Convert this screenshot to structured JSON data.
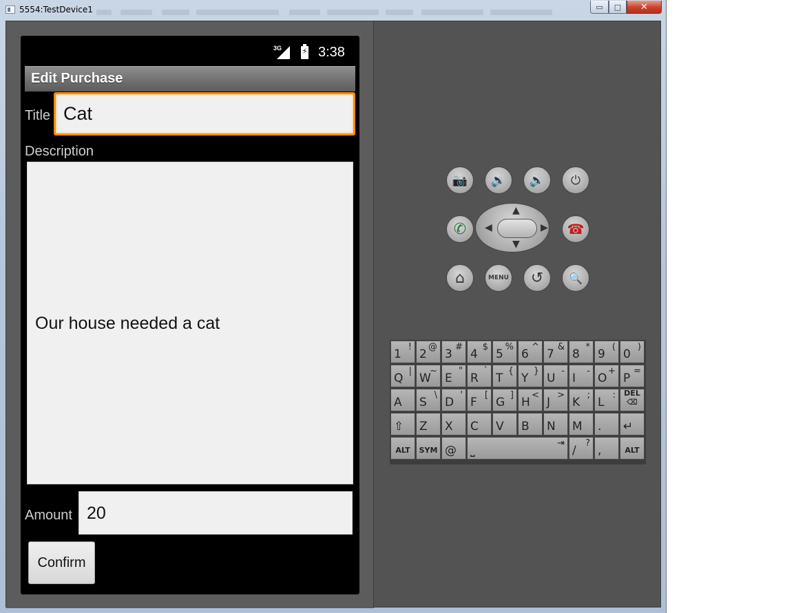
{
  "window": {
    "title": "5554:TestDevice1",
    "minimize_glyph": "▭",
    "maximize_glyph": "□",
    "close_glyph": "✕"
  },
  "status_bar": {
    "network": "3G",
    "time": "3:38"
  },
  "app": {
    "title": "Edit Purchase",
    "title_label": "Title",
    "title_value": "Cat",
    "description_label": "Description",
    "description_value": "Our house needed a cat",
    "amount_label": "Amount",
    "amount_value": "20",
    "confirm_label": "Confirm"
  },
  "controls": {
    "camera": "📷",
    "volume_down": "🔉",
    "volume_up": "🔊",
    "power": "⏻",
    "call": "✆",
    "end_call": "☎",
    "home": "⌂",
    "menu": "MENU",
    "back": "↺",
    "search": "🔍",
    "dpad_up": "▲",
    "dpad_down": "▼",
    "dpad_left": "◀",
    "dpad_right": "▶"
  },
  "keyboard": {
    "rows": [
      [
        {
          "k": "1",
          "a": "!"
        },
        {
          "k": "2",
          "a": "@"
        },
        {
          "k": "3",
          "a": "#"
        },
        {
          "k": "4",
          "a": "$"
        },
        {
          "k": "5",
          "a": "%"
        },
        {
          "k": "6",
          "a": "^"
        },
        {
          "k": "7",
          "a": "&"
        },
        {
          "k": "8",
          "a": "*"
        },
        {
          "k": "9",
          "a": "("
        },
        {
          "k": "0",
          "a": ")"
        }
      ],
      [
        {
          "k": "Q",
          "a": "|"
        },
        {
          "k": "W",
          "a": "~"
        },
        {
          "k": "E",
          "a": "\""
        },
        {
          "k": "R",
          "a": "`"
        },
        {
          "k": "T",
          "a": "{"
        },
        {
          "k": "Y",
          "a": "}"
        },
        {
          "k": "U",
          "a": "-"
        },
        {
          "k": "I",
          "a": "-"
        },
        {
          "k": "O",
          "a": "+"
        },
        {
          "k": "P",
          "a": "="
        }
      ],
      [
        {
          "k": "A",
          "a": ""
        },
        {
          "k": "S",
          "a": "\\"
        },
        {
          "k": "D",
          "a": "'"
        },
        {
          "k": "F",
          "a": "["
        },
        {
          "k": "G",
          "a": "]"
        },
        {
          "k": "H",
          "a": "<"
        },
        {
          "k": "J",
          "a": ">"
        },
        {
          "k": "K",
          "a": ";"
        },
        {
          "k": "L",
          "a": ":"
        },
        {
          "k": "DEL ⌫",
          "a": "",
          "small": true
        }
      ],
      [
        {
          "k": "⇧",
          "a": ""
        },
        {
          "k": "Z",
          "a": ""
        },
        {
          "k": "X",
          "a": ""
        },
        {
          "k": "C",
          "a": ""
        },
        {
          "k": "V",
          "a": ""
        },
        {
          "k": "B",
          "a": ""
        },
        {
          "k": "N",
          "a": ""
        },
        {
          "k": "M",
          "a": ""
        },
        {
          "k": ".",
          "a": ""
        },
        {
          "k": "↵",
          "a": ""
        }
      ]
    ],
    "bottom_row": [
      {
        "k": "ALT",
        "a": "",
        "small": true
      },
      {
        "k": "SYM",
        "a": "",
        "small": true
      },
      {
        "k": "@",
        "a": ""
      },
      {
        "k": "⎵",
        "a": "⇥",
        "wide": true
      },
      {
        "k": "/",
        "a": "?"
      },
      {
        "k": ",",
        "a": ""
      },
      {
        "k": "ALT",
        "a": "",
        "small": true
      }
    ]
  }
}
